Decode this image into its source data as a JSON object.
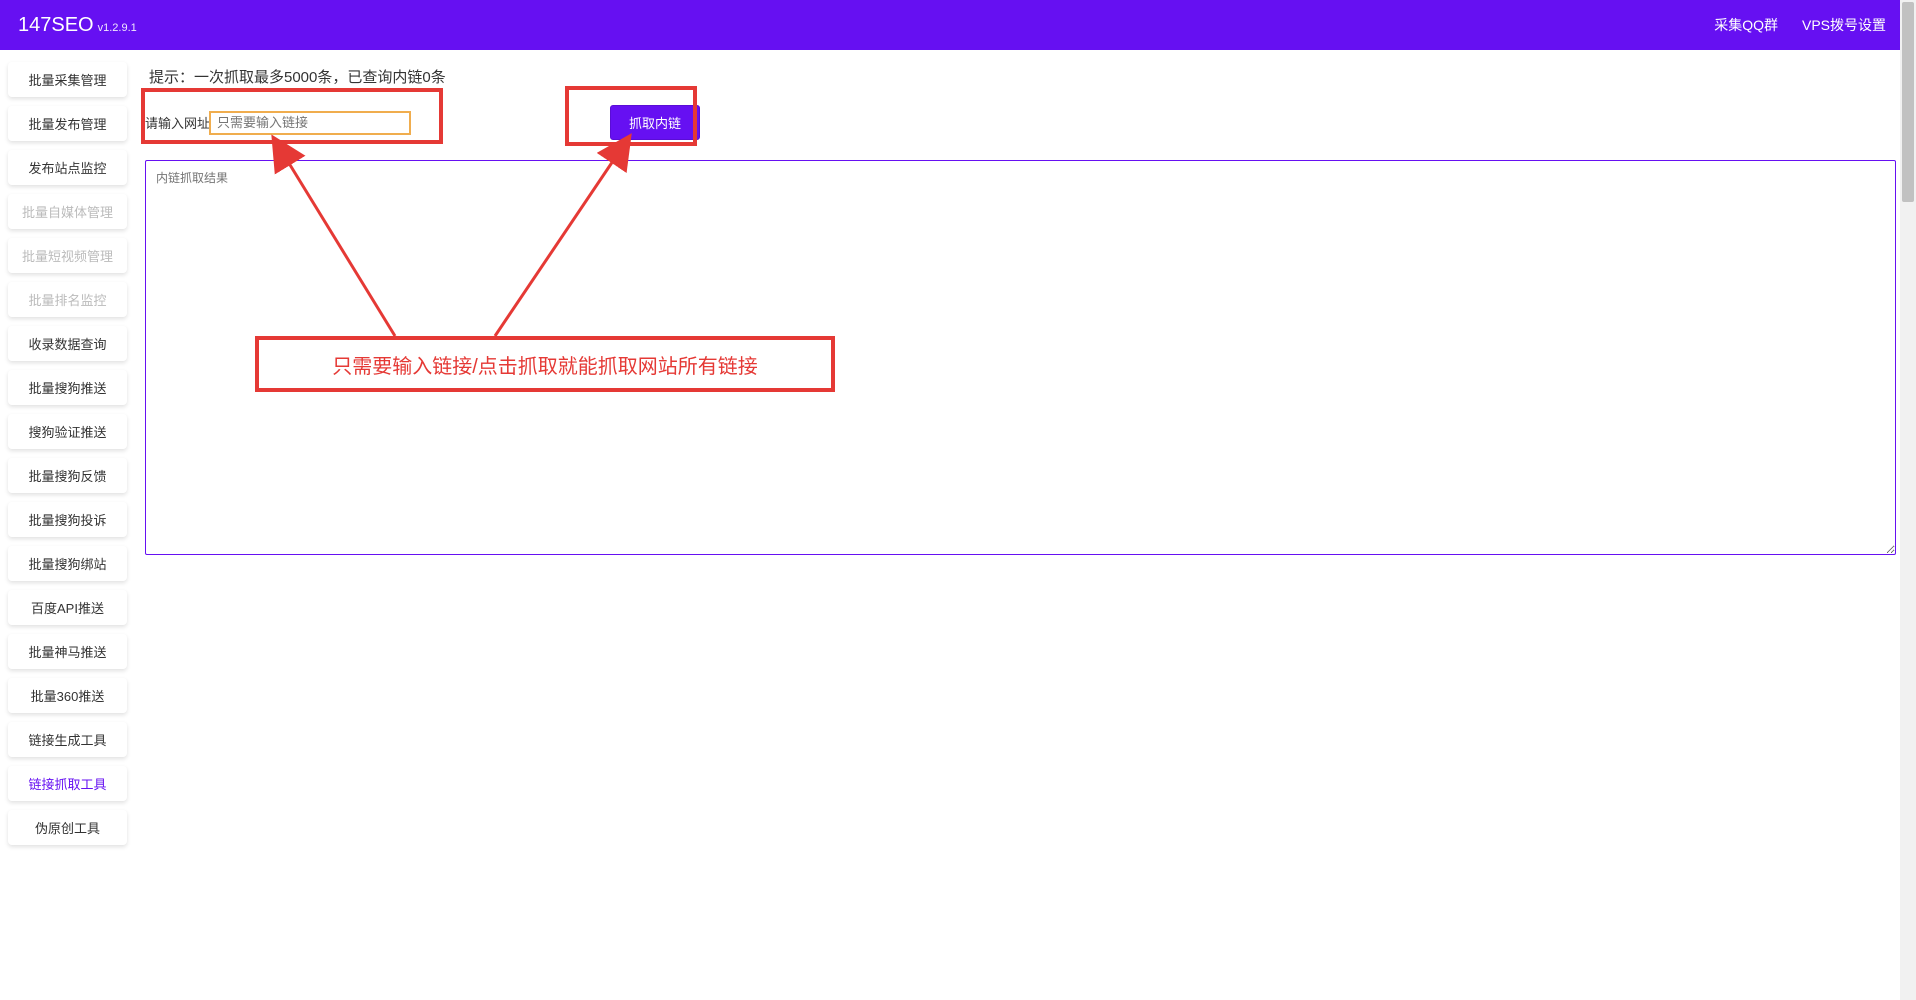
{
  "header": {
    "brand": "147SEO",
    "version": "v1.2.9.1",
    "nav": [
      {
        "label": "采集QQ群"
      },
      {
        "label": "VPS拨号设置"
      }
    ]
  },
  "sidebar": {
    "items": [
      {
        "label": "批量采集管理",
        "state": "normal"
      },
      {
        "label": "批量发布管理",
        "state": "normal"
      },
      {
        "label": "发布站点监控",
        "state": "normal"
      },
      {
        "label": "批量自媒体管理",
        "state": "disabled"
      },
      {
        "label": "批量短视频管理",
        "state": "disabled"
      },
      {
        "label": "批量排名监控",
        "state": "disabled"
      },
      {
        "label": "收录数据查询",
        "state": "normal"
      },
      {
        "label": "批量搜狗推送",
        "state": "normal"
      },
      {
        "label": "搜狗验证推送",
        "state": "normal"
      },
      {
        "label": "批量搜狗反馈",
        "state": "normal"
      },
      {
        "label": "批量搜狗投诉",
        "state": "normal"
      },
      {
        "label": "批量搜狗绑站",
        "state": "normal"
      },
      {
        "label": "百度API推送",
        "state": "normal"
      },
      {
        "label": "批量神马推送",
        "state": "normal"
      },
      {
        "label": "批量360推送",
        "state": "normal"
      },
      {
        "label": "链接生成工具",
        "state": "normal"
      },
      {
        "label": "链接抓取工具",
        "state": "active"
      },
      {
        "label": "伪原创工具",
        "state": "normal"
      }
    ]
  },
  "main": {
    "tip": "提示：一次抓取最多5000条，已查询内链0条",
    "input_label": "请输入网址",
    "input_placeholder": "只需要输入链接",
    "fetch_button": "抓取内链",
    "result_placeholder": "内链抓取结果"
  },
  "annotation": {
    "text": "只需要输入链接/点击抓取就能抓取网站所有链接",
    "color": "#e53935"
  }
}
